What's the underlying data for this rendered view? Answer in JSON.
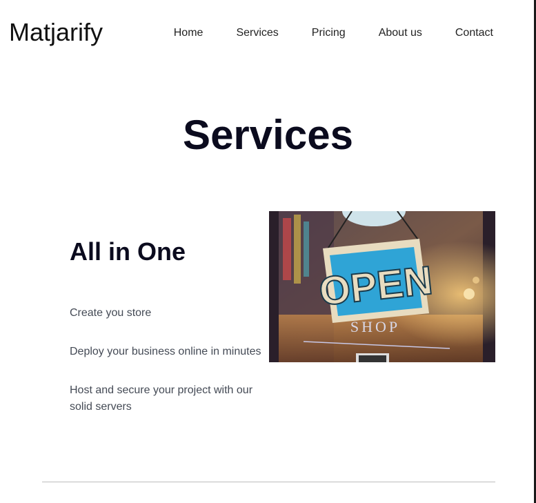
{
  "header": {
    "brand": "Matjarify",
    "nav": [
      {
        "label": "Home"
      },
      {
        "label": "Services"
      },
      {
        "label": "Pricing"
      },
      {
        "label": "About us"
      },
      {
        "label": "Contact"
      }
    ]
  },
  "services": {
    "title": "Services",
    "feature": {
      "heading": "All in One",
      "items": [
        "Create you store",
        "Deploy your business online in minutes",
        "Host and secure your project with our solid servers"
      ]
    },
    "image": {
      "sign_text": "OPEN",
      "sign_subtext": "SHOP"
    }
  },
  "colors": {
    "heading": "#0b0b1e",
    "body_text": "#444a55",
    "sign_blue": "#2fa4d6",
    "sign_cream": "#e8dcc0"
  }
}
